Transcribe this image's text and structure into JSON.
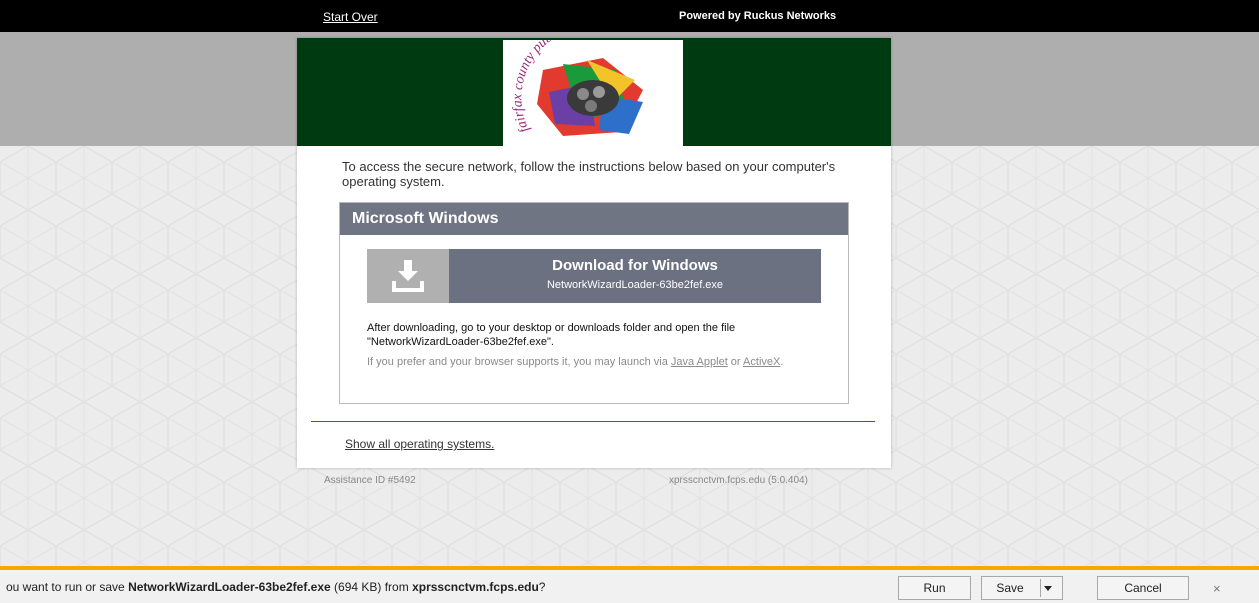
{
  "topbar": {
    "start_over": "Start Over",
    "powered_by": "Powered by Ruckus Networks"
  },
  "logo": {
    "text": "fairfax county public schools"
  },
  "card": {
    "intro": "To access the secure network, follow the instructions below based on your computer's operating system.",
    "windows_heading": "Microsoft Windows",
    "download_title": "Download for Windows",
    "download_file": "NetworkWizardLoader-63be2fef.exe",
    "after_text": "After downloading, go to your desktop or downloads folder and open the file \"NetworkWizardLoader-63be2fef.exe\".",
    "prefer_text": "If you prefer and your browser supports it, you may launch via ",
    "java_link": "Java Applet",
    "or_text": " or ",
    "activex_link": "ActiveX",
    "period": ".",
    "show_all": "Show all operating systems."
  },
  "footer": {
    "assistance_id": "Assistance ID #5492",
    "host": "xprsscnctvm.fcps.edu (5.0.404)"
  },
  "download_bar": {
    "prefix": "ou want to run or save ",
    "file": "NetworkWizardLoader-63be2fef.exe",
    "size": " (694 KB) from ",
    "source": "xprsscnctvm.fcps.edu",
    "suffix": "?",
    "run": "Run",
    "save": "Save",
    "cancel": "Cancel",
    "close": "×"
  },
  "colors": {
    "header_green": "#003a10",
    "accent_orange": "#f5a800",
    "divider_red": "#c8202f",
    "button_slate": "#6b7181"
  }
}
